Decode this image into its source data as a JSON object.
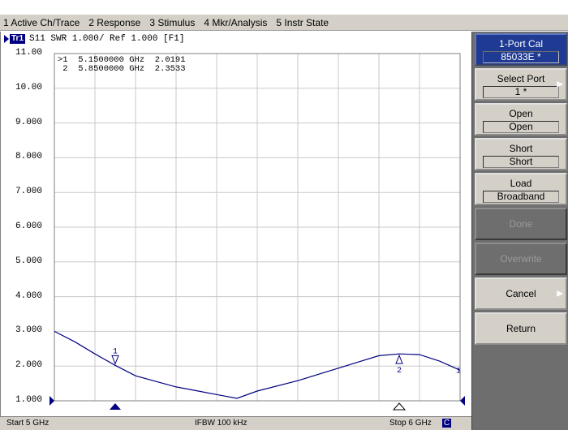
{
  "menu": {
    "items": [
      "1 Active Ch/Trace",
      "2 Response",
      "3 Stimulus",
      "4 Mkr/Analysis",
      "5 Instr State"
    ]
  },
  "trace": {
    "badge": "Tr1",
    "header_text": "S11  SWR 1.000/ Ref 1.000 [F1]",
    "color": "#000080"
  },
  "markers": [
    {
      "row": ">1  5.1500000 GHz  2.0191",
      "label": "1",
      "x_ghz": 5.15,
      "y": 2.0191,
      "active": true
    },
    {
      "row": " 2  5.8500000 GHz  2.3533",
      "label": "2",
      "x_ghz": 5.85,
      "y": 2.3533,
      "active": false
    }
  ],
  "bottom": {
    "start": "Start 5 GHz",
    "ifbw": "IFBW 100 kHz",
    "stop": "Stop 6 GHz",
    "cont": "C"
  },
  "softkeys": {
    "header": {
      "title": "1-Port Cal",
      "value": "85033E *"
    },
    "select_port": {
      "title": "Select Port",
      "value": "1 *"
    },
    "open": {
      "title": "Open",
      "value": "Open"
    },
    "short": {
      "title": "Short",
      "value": "Short"
    },
    "load": {
      "title": "Load",
      "value": "Broadband"
    },
    "done": "Done",
    "overwrite": "Overwrite",
    "cancel": "Cancel",
    "return": "Return"
  },
  "chart_data": {
    "type": "line",
    "ylim": [
      1.0,
      11.0
    ],
    "xlim": [
      5.0,
      6.0
    ],
    "ytick_labels": [
      "11.00",
      "10.00",
      "9.000",
      "8.000",
      "7.000",
      "6.000",
      "5.000",
      "4.000",
      "3.000",
      "2.000",
      "1.000"
    ],
    "ytick_values": [
      11,
      10,
      9,
      8,
      7,
      6,
      5,
      4,
      3,
      2,
      1
    ],
    "grid": true,
    "series": [
      {
        "x": [
          5.0,
          5.05,
          5.1,
          5.15,
          5.2,
          5.3,
          5.4,
          5.45,
          5.5,
          5.6,
          5.7,
          5.75,
          5.8,
          5.85,
          5.9,
          5.95,
          6.0
        ],
        "y": [
          3.0,
          2.7,
          2.35,
          2.02,
          1.72,
          1.4,
          1.18,
          1.07,
          1.28,
          1.58,
          1.94,
          2.12,
          2.3,
          2.35,
          2.33,
          2.14,
          1.88
        ]
      }
    ],
    "end_label": "1"
  }
}
